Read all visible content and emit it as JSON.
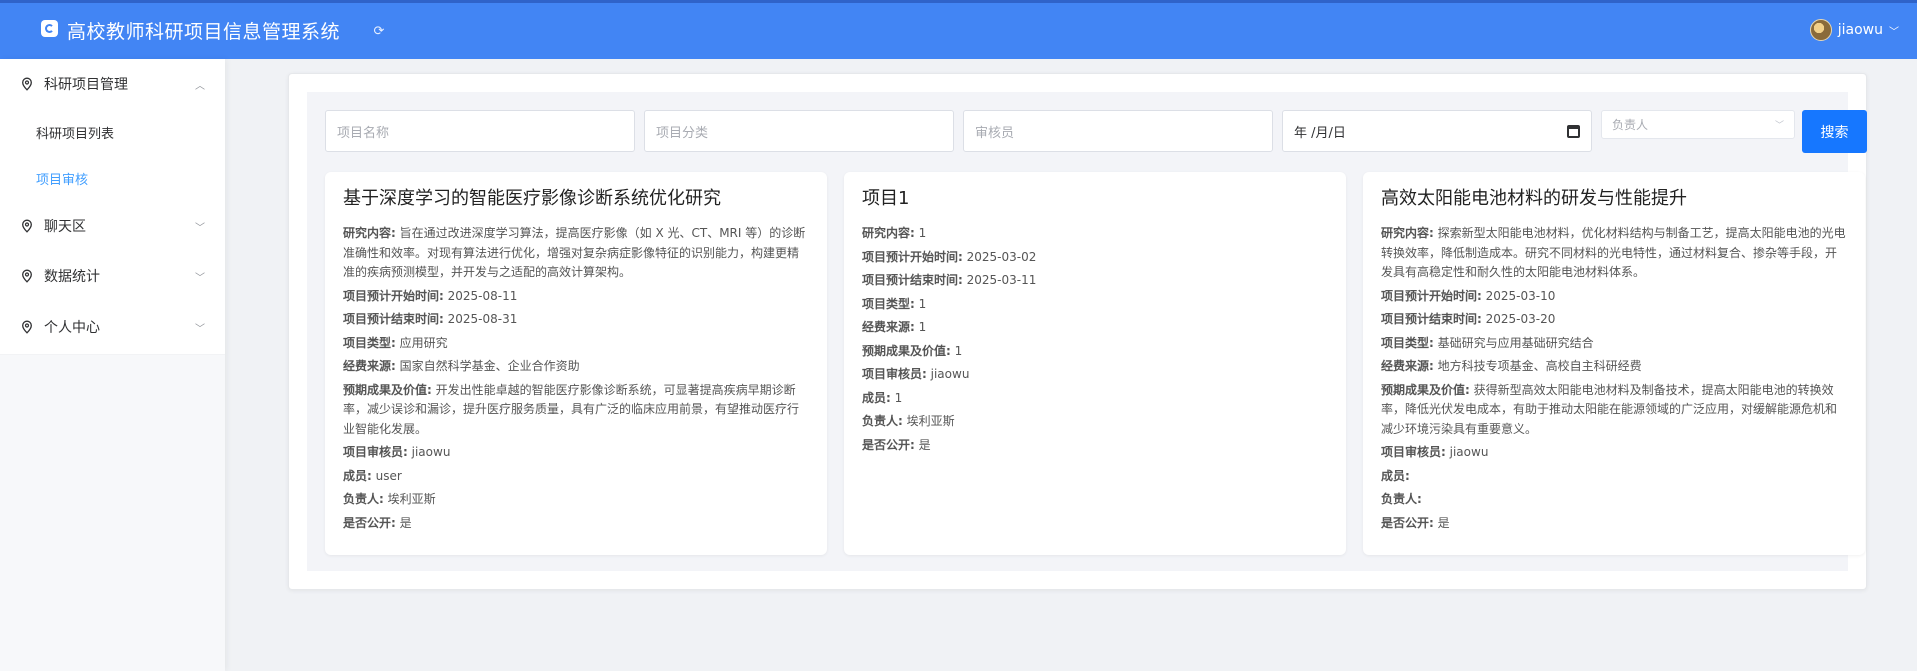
{
  "header": {
    "app_title": "高校教师科研项目信息管理系统",
    "username": "jiaowu",
    "icons": {
      "logo": "logo-icon",
      "refresh": "refresh-icon",
      "caret": "chevron-down-icon"
    }
  },
  "sidebar": {
    "groups": [
      {
        "label": "科研项目管理",
        "expanded": true
      },
      {
        "label": "聊天区",
        "expanded": false
      },
      {
        "label": "数据统计",
        "expanded": false
      },
      {
        "label": "个人中心",
        "expanded": false
      }
    ],
    "sub_items": [
      {
        "label": "科研项目列表",
        "active": false
      },
      {
        "label": "项目审核",
        "active": true
      }
    ],
    "active_color": "#409eff"
  },
  "search": {
    "project_name_placeholder": "项目名称",
    "category_placeholder": "项目分类",
    "reviewer_placeholder": "审核员",
    "date_value": "年 /月/日",
    "leader_placeholder": "负责人",
    "search_label": "搜索"
  },
  "labels": {
    "content": "研究内容:",
    "start": "项目预计开始时间:",
    "end": "项目预计结束时间:",
    "type": "项目类型:",
    "fund": "经费来源:",
    "outcome": "预期成果及价值:",
    "reviewer": "项目审核员:",
    "members": "成员:",
    "leader": "负责人:",
    "public": "是否公开:"
  },
  "cards": [
    {
      "title": "基于深度学习的智能医疗影像诊断系统优化研究",
      "content": "旨在通过改进深度学习算法，提高医疗影像（如 X 光、CT、MRI 等）的诊断准确性和效率。对现有算法进行优化，增强对复杂病症影像特征的识别能力，构建更精准的疾病预测模型，并开发与之适配的高效计算架构。",
      "start": "2025-08-11",
      "end": "2025-08-31",
      "type": "应用研究",
      "fund": "国家自然科学基金、企业合作资助",
      "outcome": "开发出性能卓越的智能医疗影像诊断系统，可显著提高疾病早期诊断率，减少误诊和漏诊，提升医疗服务质量，具有广泛的临床应用前景，有望推动医疗行业智能化发展。",
      "reviewer": "jiaowu",
      "members": "user",
      "leader": "埃利亚斯",
      "public": "是"
    },
    {
      "title": "项目1",
      "content": "1",
      "start": "2025-03-02",
      "end": "2025-03-11",
      "type": "1",
      "fund": "1",
      "outcome": "1",
      "reviewer": "jiaowu",
      "members": "1",
      "leader": "埃利亚斯",
      "public": "是"
    },
    {
      "title": "高效太阳能电池材料的研发与性能提升",
      "content": "探索新型太阳能电池材料，优化材料结构与制备工艺，提高太阳能电池的光电转换效率，降低制造成本。研究不同材料的光电特性，通过材料复合、掺杂等手段，开发具有高稳定性和耐久性的太阳能电池材料体系。",
      "start": "2025-03-10",
      "end": "2025-03-20",
      "type": "基础研究与应用基础研究结合",
      "fund": "地方科技专项基金、高校自主科研经费",
      "outcome": "获得新型高效太阳能电池材料及制备技术，提高太阳能电池的转换效率，降低光伏发电成本，有助于推动太阳能在能源领域的广泛应用，对缓解能源危机和减少环境污染具有重要意义。",
      "reviewer": "jiaowu",
      "members": "",
      "leader": "",
      "public": "是"
    }
  ],
  "colors": {
    "header": "#4285f4",
    "primary_button": "#1677ff"
  }
}
